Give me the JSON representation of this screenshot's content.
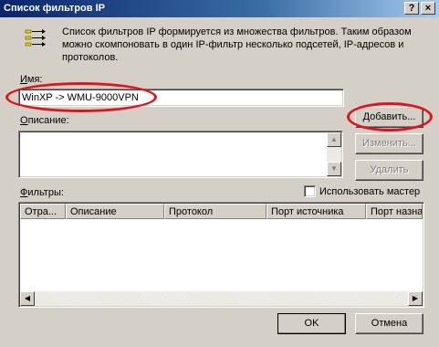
{
  "window": {
    "title": "Список фильтров IP",
    "help_label": "?",
    "close_label": "×"
  },
  "icon": "filter-list-icon",
  "description": "Список фильтров IP формируется из множества фильтров. Таким образом можно скомпоновать в один IP-фильтр несколько подсетей, IP-адресов и протоколов.",
  "name_label": "Имя:",
  "name_value": "WinXP -> WMU-9000VPN",
  "desc_label": "Описание:",
  "desc_value": "",
  "buttons": {
    "add": "Добавить...",
    "edit": "Изменить...",
    "delete": "Удалить",
    "ok": "OK",
    "cancel": "Отмена"
  },
  "filters_label": "Фильтры:",
  "use_wizard_label": "Использовать мастер",
  "use_wizard_checked": false,
  "table": {
    "columns": [
      "Отра...",
      "Описание",
      "Протокол",
      "Порт источника",
      "Порт назна"
    ],
    "rows": []
  },
  "scroll_arrows": {
    "up": "▲",
    "down": "▼",
    "left": "◀",
    "right": "▶"
  },
  "highlight_color": "#e0141c"
}
